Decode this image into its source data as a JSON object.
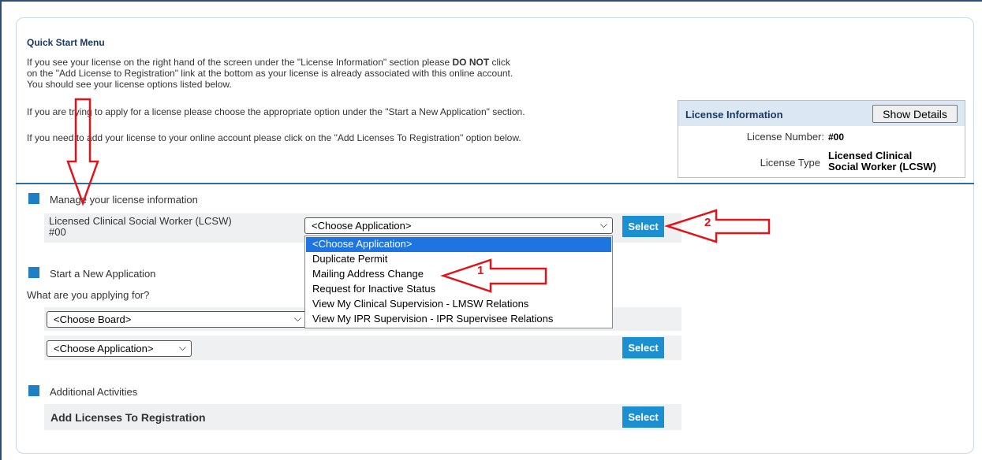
{
  "quick_start": {
    "title": "Quick Start Menu",
    "para1_a": "If you see your license on the right hand of the screen under the \"License Information\" section please ",
    "para1_bold": "DO NOT",
    "para1_b": " click",
    "para1_line2": "on the \"Add License to Registration\" link at the bottom as your license is already associated with this online account.",
    "para1_line3": "You should see your license options listed below.",
    "para2": "If you are trying to apply for a license please choose the appropriate option under the \"Start a New Application\" section.",
    "para3": "If you need to add your license to your online account please click on the \"Add Licenses To Registration\" option below."
  },
  "license_info": {
    "title": "License Information",
    "show_details": "Show Details",
    "number_label": "License Number:",
    "number_value": "#00",
    "type_label": "License Type",
    "type_value_line1": "Licensed Clinical",
    "type_value_line2": "Social Worker (LCSW)"
  },
  "manage": {
    "title": "Manage your license information",
    "license_name": "Licensed Clinical Social Worker (LCSW)",
    "license_number": "#00",
    "select_value": "<Choose Application>",
    "select_button": "Select",
    "dropdown_options": [
      "<Choose Application>",
      "Duplicate Permit",
      "Mailing Address Change",
      "Request for Inactive Status",
      "View My Clinical Supervision - LMSW Relations",
      "View My IPR Supervision - IPR Supervisee Relations"
    ]
  },
  "new_application": {
    "title": "Start a New Application",
    "question": "What are you applying for?",
    "board_select_value": "<Choose Board>",
    "application_select_value": "<Choose Application>",
    "select_button": "Select"
  },
  "additional": {
    "title": "Additional Activities",
    "add_licenses_label": "Add Licenses To Registration",
    "select_button": "Select"
  },
  "annotations": {
    "arrow1_label": "1",
    "arrow2_label": "2",
    "arrow_color": "#e0141b"
  }
}
